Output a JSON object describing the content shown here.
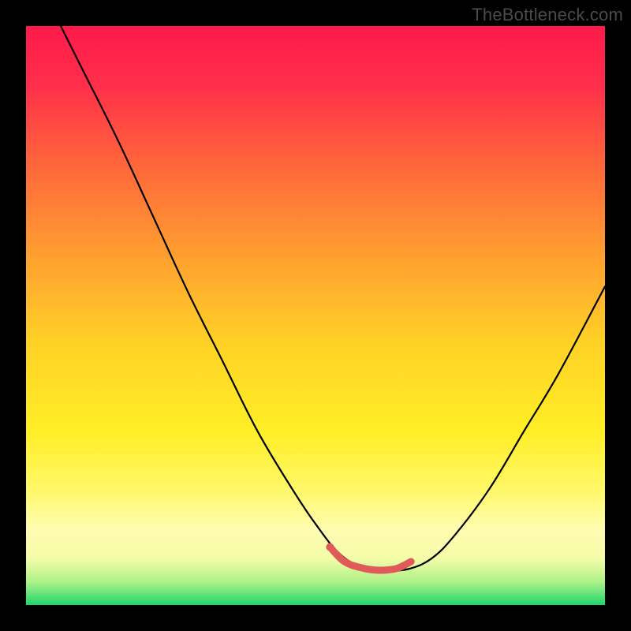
{
  "watermark": "TheBottleneck.com",
  "colors": {
    "black": "#000000",
    "curve_main": "#000000",
    "highlight": "#e05a5a",
    "gradient_stops": [
      {
        "offset": 0,
        "color": "#ff1a4b"
      },
      {
        "offset": 0.1,
        "color": "#ff2e4a"
      },
      {
        "offset": 0.25,
        "color": "#ff6a3a"
      },
      {
        "offset": 0.4,
        "color": "#ffa030"
      },
      {
        "offset": 0.55,
        "color": "#ffd226"
      },
      {
        "offset": 0.7,
        "color": "#ffee26"
      },
      {
        "offset": 0.8,
        "color": "#fff868"
      },
      {
        "offset": 0.87,
        "color": "#fffcb0"
      },
      {
        "offset": 0.92,
        "color": "#f4fca8"
      },
      {
        "offset": 0.96,
        "color": "#aef28a"
      },
      {
        "offset": 1.0,
        "color": "#1fd66a"
      }
    ]
  },
  "chart_data": {
    "type": "line",
    "title": "",
    "xlabel": "",
    "ylabel": "",
    "xlim": [
      0,
      100
    ],
    "ylim": [
      0,
      100
    ],
    "note": "x/y are fractional positions within the 734x734 plot area; y=0 is top, y=100 is bottom (green). Curve origin in screenshot: the black line starts at the top-left edge, dives to a flat minimum near x≈55–65 (highlighted in salmon), then rises toward the right edge at mid-height.",
    "series": [
      {
        "name": "bottleneck-curve",
        "stroke": "#000000",
        "x": [
          6.0,
          10.0,
          16.0,
          22.0,
          28.0,
          34.0,
          40.0,
          46.0,
          50.0,
          54.0,
          58.0,
          62.0,
          66.0,
          70.0,
          74.0,
          80.0,
          86.0,
          92.0,
          100.0
        ],
        "y": [
          0.0,
          8.0,
          20.0,
          33.0,
          46.0,
          58.0,
          70.0,
          80.0,
          86.0,
          91.0,
          93.5,
          94.0,
          93.8,
          92.0,
          88.0,
          80.0,
          70.0,
          60.0,
          45.0
        ]
      },
      {
        "name": "minimum-highlight",
        "stroke": "#e05a5a",
        "x": [
          52.5,
          55.0,
          58.0,
          61.0,
          64.0,
          66.5
        ],
        "y": [
          90.0,
          92.5,
          93.6,
          94.0,
          93.7,
          92.5
        ]
      }
    ]
  }
}
